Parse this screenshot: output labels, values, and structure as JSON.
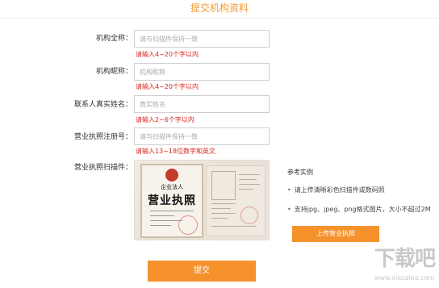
{
  "header": {
    "title": "提交机构资料"
  },
  "form": {
    "fields": [
      {
        "label": "机构全称：",
        "placeholder": "请与扫描件保持一致",
        "error": "请输入4~20个字以内"
      },
      {
        "label": "机构昵称：",
        "placeholder": "机构昵称",
        "error": "请输入4~20个字以内"
      },
      {
        "label": "联系人真实姓名：",
        "placeholder": "真实姓名",
        "error": "请输入2~6个字以内"
      },
      {
        "label": "营业执照注册号：",
        "placeholder": "请与扫描件保持一致",
        "error": "请输入13~18位数字和英文"
      }
    ],
    "scan_label": "营业执照扫描件：",
    "license_image": {
      "heading_small": "企业法人",
      "heading_big": "营业执照"
    },
    "reference": {
      "title": "参考实例",
      "items": [
        "请上传清晰彩色扫描件或数码照",
        "支持jpg、jpeg、png格式图片，大小不超过2M"
      ]
    },
    "upload_label": "上传营业执照",
    "submit_label": "提交"
  },
  "watermark": {
    "big": "下载吧",
    "small": "www.xiazaiba.com"
  },
  "colors": {
    "accent": "#f5922c",
    "title": "#f39a36",
    "error": "#d9251c"
  }
}
